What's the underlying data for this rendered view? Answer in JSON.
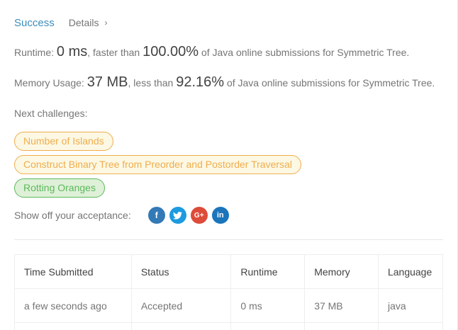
{
  "header": {
    "status": "Success",
    "details_label": "Details",
    "details_chevron": "›"
  },
  "runtime": {
    "prefix": "Runtime: ",
    "value": "0 ms",
    "middle": ", faster than ",
    "percent": "100.00%",
    "suffix": " of Java online submissions for Symmetric Tree."
  },
  "memory": {
    "prefix": "Memory Usage: ",
    "value": "37 MB",
    "middle": ", less than ",
    "percent": "92.16%",
    "suffix": " of Java online submissions for Symmetric Tree."
  },
  "next_challenges": {
    "label": "Next challenges:",
    "items": [
      {
        "label": "Number of Islands",
        "difficulty": "medium"
      },
      {
        "label": "Construct Binary Tree from Preorder and Postorder Traversal",
        "difficulty": "medium"
      },
      {
        "label": "Rotting Oranges",
        "difficulty": "easy"
      }
    ]
  },
  "share": {
    "label": "Show off your acceptance:",
    "icons": [
      {
        "name": "facebook-icon",
        "glyph": "f"
      },
      {
        "name": "twitter-icon",
        "glyph": "t"
      },
      {
        "name": "google-plus-icon",
        "glyph": "G+"
      },
      {
        "name": "linkedin-icon",
        "glyph": "in"
      }
    ]
  },
  "table": {
    "headers": [
      "Time Submitted",
      "Status",
      "Runtime",
      "Memory",
      "Language"
    ],
    "rows": [
      {
        "time": "a few seconds ago",
        "status": "Accepted",
        "runtime": "0 ms",
        "memory": "37 MB",
        "language": "java"
      }
    ]
  },
  "colors": {
    "success": "#5cb85c",
    "link": "#3c8dbc",
    "medium": "#f0ad4e",
    "easy": "#5cb85c"
  }
}
